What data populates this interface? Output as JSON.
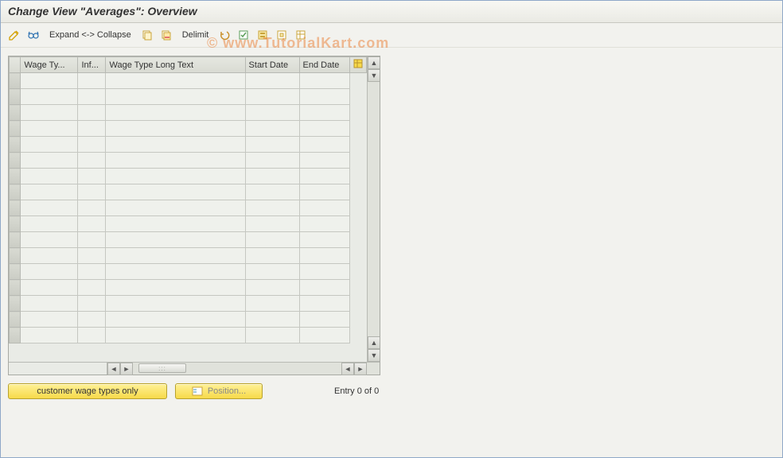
{
  "header": {
    "title": "Change View \"Averages\": Overview"
  },
  "toolbar": {
    "expand_collapse": "Expand <-> Collapse",
    "delimit": "Delimit"
  },
  "table": {
    "columns": {
      "wage_type": "Wage Ty...",
      "inf": "Inf...",
      "wage_long": "Wage Type Long Text",
      "start_date": "Start Date",
      "end_date": "End Date"
    },
    "row_count": 17
  },
  "footer": {
    "customer_btn": "customer wage types only",
    "position_btn": "Position...",
    "entry_text": "Entry 0 of 0"
  },
  "watermark": "© www.TutorialKart.com"
}
